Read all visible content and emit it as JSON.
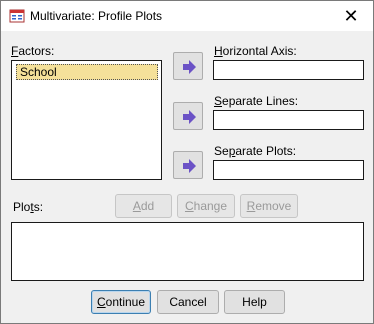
{
  "window": {
    "title": "Multivariate: Profile Plots",
    "close_glyph": "✕"
  },
  "factors": {
    "label": "Factors:",
    "underline": "F",
    "label_rest": "actors:",
    "items": [
      "School"
    ],
    "selected_index": 0
  },
  "axes": {
    "horizontal": {
      "prefix": "",
      "underline": "H",
      "rest": "orizontal Axis:",
      "value": ""
    },
    "separate_lines": {
      "prefix": "",
      "underline": "S",
      "rest": "eparate Lines:",
      "value": ""
    },
    "separate_plots": {
      "prefix": "Se",
      "underline": "p",
      "rest": "arate Plots:",
      "value": ""
    }
  },
  "plots": {
    "prefix": "Plo",
    "underline": "t",
    "rest": "s:",
    "items": []
  },
  "plot_buttons": {
    "add": {
      "label": "Add",
      "underline": "A",
      "rest": "dd"
    },
    "change": {
      "label": "Change",
      "underline": "C",
      "rest": "hange"
    },
    "remove": {
      "label": "Remove",
      "underline": "R",
      "rest": "emove"
    }
  },
  "footer": {
    "continue": {
      "underline": "C",
      "rest": "ontinue"
    },
    "cancel": "Cancel",
    "help": "Help"
  },
  "colors": {
    "arrow_button": "#6b52c6",
    "selected_item": "#f5e19a"
  },
  "icons": {
    "app": "spss-dialog-icon",
    "arrow": "move-right-arrow-icon"
  }
}
